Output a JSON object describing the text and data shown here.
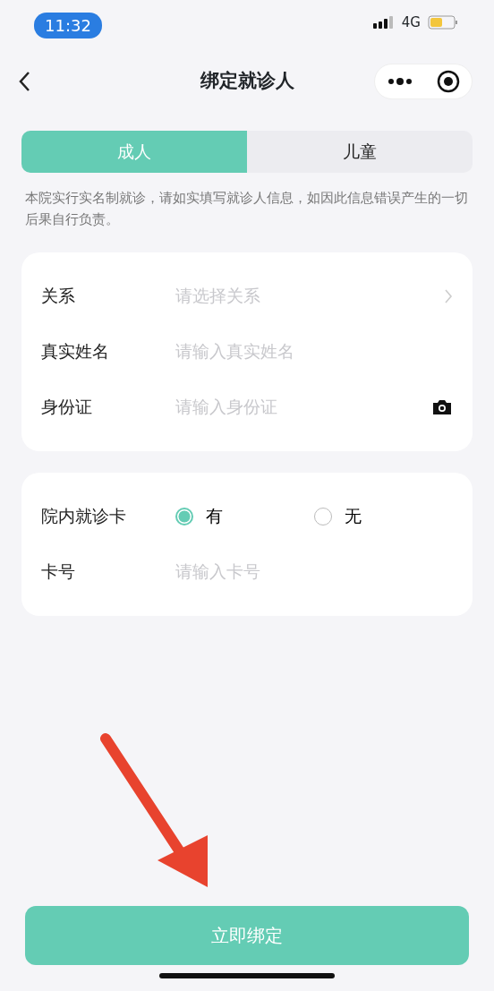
{
  "status_bar": {
    "time": "11:32",
    "network": "4G"
  },
  "nav": {
    "title": "绑定就诊人"
  },
  "tabs": [
    {
      "label": "成人",
      "selected": true
    },
    {
      "label": "儿童",
      "selected": false
    }
  ],
  "notice": "本院实行实名制就诊，请如实填写就诊人信息，如因此信息错误产生的一切后果自行负责。",
  "form_fields": [
    {
      "kind": "select",
      "label": "关系",
      "placeholder": "请选择关系"
    },
    {
      "kind": "input",
      "label": "真实姓名",
      "placeholder": "请输入真实姓名"
    },
    {
      "kind": "camera",
      "label": "身份证",
      "placeholder": "请输入身份证"
    }
  ],
  "card_section": {
    "label": "院内就诊卡",
    "options": [
      {
        "label": "有",
        "selected": true
      },
      {
        "label": "无",
        "selected": false
      }
    ],
    "card_number": {
      "label": "卡号",
      "placeholder": "请输入卡号"
    }
  },
  "submit_button": "立即绑定"
}
